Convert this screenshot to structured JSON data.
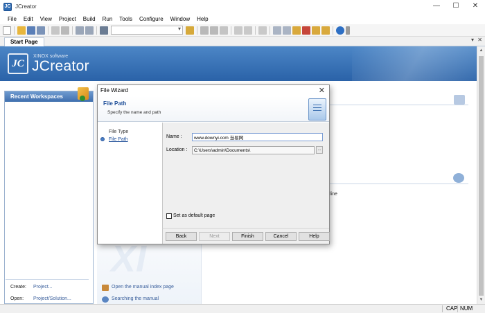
{
  "window": {
    "title": "JCreator",
    "controls": [
      "—",
      "☐",
      "✕"
    ]
  },
  "menu": [
    "File",
    "Edit",
    "View",
    "Project",
    "Build",
    "Run",
    "Tools",
    "Configure",
    "Window",
    "Help"
  ],
  "tabs": {
    "active": "Start Page",
    "arrow": "▾",
    "close": "✕"
  },
  "banner": {
    "brand_sub": "XINOX software",
    "brand_name": "JCreator",
    "logo_text": "JC"
  },
  "left_panel": {
    "header": "Recent Workspaces",
    "create_label": "Create:",
    "create_link": "Project...",
    "open_label": "Open:",
    "open_link": "Project/Solution..."
  },
  "center_links": [
    "Open the manual index page",
    "Searching the manual"
  ],
  "right_text": "line",
  "watermark": "XI",
  "status": {
    "cap": "CAP",
    "num": "NUM"
  },
  "dialog": {
    "title": "File Wizard",
    "close": "✕",
    "header_title": "File Path",
    "header_subtitle": "Specify the name and path",
    "steps": [
      "File Type",
      "File Path"
    ],
    "name_label": "Name :",
    "name_value": "www.downyi.com 当易网",
    "location_label": "Location :",
    "location_value": "C:\\Users\\admin\\Documents\\",
    "browse_label": "...",
    "default_checkbox_label": "Set as default page",
    "buttons": {
      "back": "Back",
      "next": "Next",
      "finish": "Finish",
      "cancel": "Cancel",
      "help": "Help"
    }
  }
}
